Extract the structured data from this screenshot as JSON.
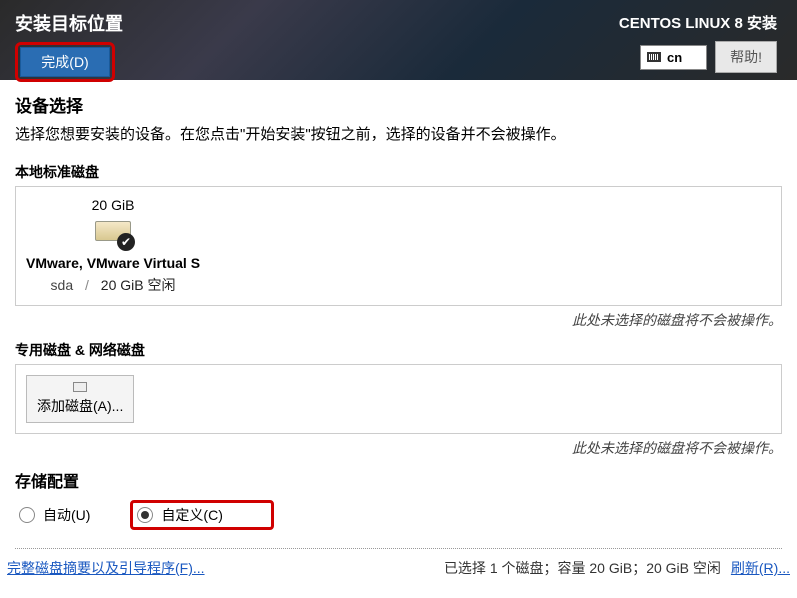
{
  "header": {
    "title": "安装目标位置",
    "done_button": "完成(D)",
    "distro": "CENTOS LINUX 8 安装",
    "keyboard_layout": "cn",
    "help_button": "帮助!"
  },
  "device_selection": {
    "title": "设备选择",
    "description": "选择您想要安装的设备。在您点击\"开始安装\"按钮之前，选择的设备并不会被操作。"
  },
  "local_disks": {
    "label": "本地标准磁盘",
    "items": [
      {
        "size": "20 GiB",
        "name": "VMware, VMware Virtual S",
        "dev": "sda",
        "free": "20 GiB 空闲",
        "selected": true
      }
    ],
    "note": "此处未选择的磁盘将不会被操作。"
  },
  "special_disks": {
    "label": "专用磁盘 & 网络磁盘",
    "add_disk_label": "添加磁盘(A)...",
    "note": "此处未选择的磁盘将不会被操作。"
  },
  "storage_config": {
    "title": "存储配置",
    "auto_label": "自动(U)",
    "custom_label": "自定义(C)",
    "selected": "custom"
  },
  "footer": {
    "full_summary_link": "完整磁盘摘要以及引导程序(F)...",
    "selection_summary": "已选择 1 个磁盘；容量 20 GiB；20 GiB 空闲",
    "refresh_link": "刷新(R)..."
  }
}
